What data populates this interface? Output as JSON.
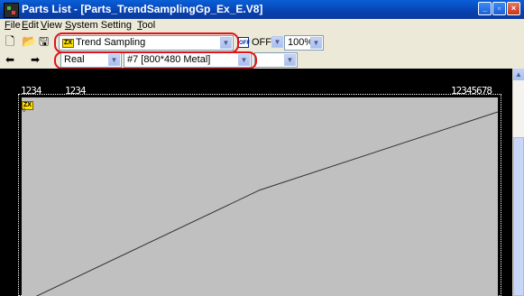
{
  "window": {
    "title": "Parts List - [Parts_TrendSamplingGp_Ex_E.V8]",
    "controls": {
      "minimize": "_",
      "restore": "▫",
      "close": "×"
    }
  },
  "menu": [
    {
      "label": "File",
      "key": "F",
      "rest": "ile"
    },
    {
      "label": "Edit",
      "key": "E",
      "rest": "dit"
    },
    {
      "label": "View",
      "key": "V",
      "rest": "iew"
    },
    {
      "label": "System Setting",
      "key": "S",
      "rest": "ystem Setting"
    },
    {
      "label": "Tool",
      "key": "T",
      "rest": "ool"
    }
  ],
  "toolbar": {
    "part_combo": {
      "badge": "ZX",
      "value": "Trend Sampling"
    },
    "off_badge": "OFF",
    "state_combo": {
      "value": "OFF"
    },
    "zoom_combo": {
      "value": "100%"
    },
    "value_type_combo": {
      "value": "Real"
    },
    "screen_combo": {
      "value": "#7 [800*480 Metal]"
    },
    "extra_combo": {
      "value": ""
    }
  },
  "canvas": {
    "label_left_1": "1234",
    "label_left_2": "1234",
    "label_right": "12345678",
    "part_badge": "ZX",
    "part_dot": "0",
    "trend_polyline": [
      [
        0.0,
        0.0
      ],
      [
        0.5,
        0.55
      ],
      [
        1.0,
        0.93
      ]
    ]
  },
  "colors": {
    "highlight": "#e0131a",
    "screen_bg": "#c0c0c0",
    "canvas_bg": "#000000",
    "titlebar": "#0842b0"
  }
}
